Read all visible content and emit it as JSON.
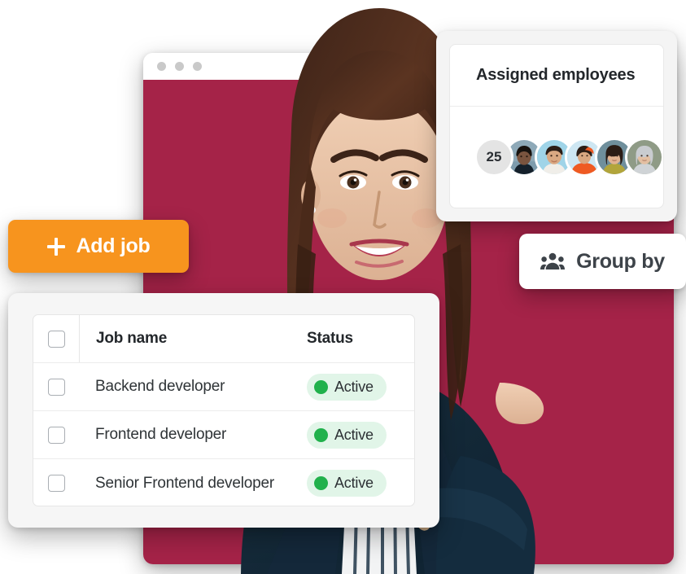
{
  "browser_window": {
    "traffic_lights": [
      "dot-1",
      "dot-2",
      "dot-3"
    ],
    "body_color": "#a52348"
  },
  "assigned_employees": {
    "title": "Assigned employees",
    "count": "25",
    "avatars": [
      {
        "name": "avatar-1",
        "bg": "#8ea9b8",
        "skin": "#6b4a3a",
        "hair": "#1d1a18",
        "top": "#14202b"
      },
      {
        "name": "avatar-2",
        "bg": "#9fd4e8",
        "skin": "#d9a882",
        "hair": "#2b1d16",
        "top": "#f0eee9"
      },
      {
        "name": "avatar-3",
        "bg": "#cde6f2",
        "skin": "#d9a882",
        "hair": "#2b1d16",
        "top": "#ef5a22"
      },
      {
        "name": "avatar-4",
        "bg": "#6f8f9c",
        "skin": "#e0b392",
        "hair": "#2a1c15",
        "top": "#b2a53a"
      },
      {
        "name": "avatar-5",
        "bg": "#8f9b86",
        "skin": "#e3bfa2",
        "hair": "#c9ccd0",
        "top": "#cfd3d6"
      }
    ]
  },
  "add_job_button": {
    "label": "Add job",
    "icon": "plus-icon",
    "color": "#f7941e"
  },
  "group_by_button": {
    "label": "Group by",
    "icon": "people-group-icon"
  },
  "jobs_table": {
    "columns": [
      "Job name",
      "Status"
    ],
    "header_checkbox": "unchecked",
    "rows": [
      {
        "checkbox": "unchecked",
        "job_name": "Backend developer",
        "status": "Active"
      },
      {
        "checkbox": "unchecked",
        "job_name": "Frontend developer",
        "status": "Active"
      },
      {
        "checkbox": "unchecked",
        "job_name": "Senior Frontend developer",
        "status": "Active"
      }
    ],
    "status_colors": {
      "dot": "#21b14c",
      "pill": "#e1f5e8",
      "text": "#2c3034"
    }
  }
}
